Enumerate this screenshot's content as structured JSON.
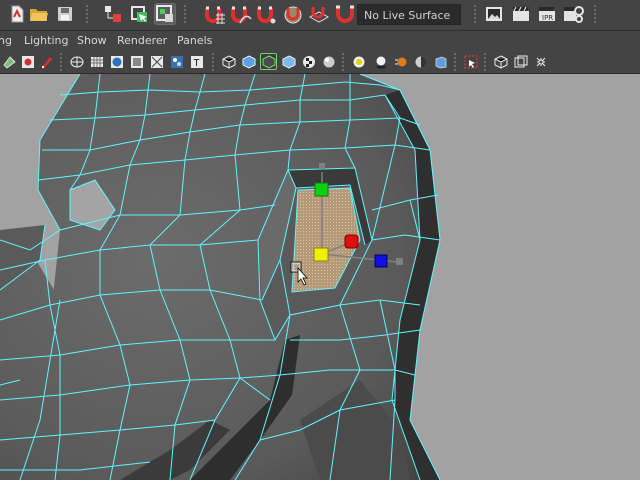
{
  "toolbar": {
    "live_surface_label": "No Live Surface"
  },
  "menu": {
    "items": [
      "ng",
      "Lighting",
      "Show",
      "Renderer",
      "Panels"
    ]
  },
  "icons": {
    "toolbar": [
      "new-scene-icon",
      "open-scene-icon",
      "save-scene-icon",
      "select-hierarchy-icon",
      "select-object-icon",
      "select-component-icon",
      "snap-grid-icon",
      "snap-curve-icon",
      "snap-point-icon",
      "snap-view-plane-icon",
      "snap-surface-icon",
      "make-live-icon",
      "render-view-icon",
      "render-current-icon",
      "ipr-render-icon",
      "render-settings-icon"
    ],
    "panel": [
      "camera-attributes-icon",
      "bookmark-icon",
      "image-plane-icon",
      "wireframe-icon",
      "grid-icon",
      "smooth-shade-icon",
      "flat-shade-icon",
      "bounding-box-icon",
      "texture-icon",
      "xray-icon",
      "default-light-icon",
      "wireframe-on-shaded-icon",
      "shaded-icon",
      "checker-icon",
      "textured-icon",
      "use-all-lights-icon",
      "shadows-icon",
      "ambient-occlusion-icon",
      "motion-blur-icon",
      "depth-of-field-icon",
      "isolate-select-icon",
      "resolution-gate-icon",
      "gate-mask-icon",
      "manipulator-icon"
    ]
  },
  "colors": {
    "ui_bg": "#444444",
    "viewport_bg": "#a2a2a2",
    "mesh_fill": "#5e5e5e",
    "wire": "#5ff5ff",
    "selected_face": "#b49a78",
    "axis_x": "#e01010",
    "axis_y": "#10d010",
    "axis_z": "#1010e0",
    "axis_center": "#f0f000"
  }
}
